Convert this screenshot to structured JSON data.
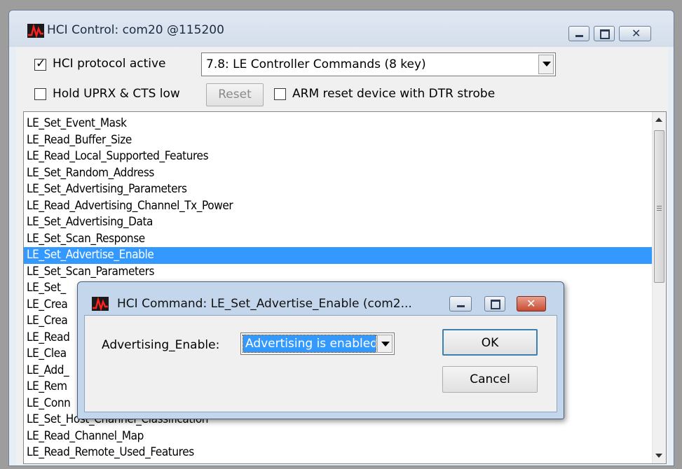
{
  "main_window": {
    "title": "HCI Control: com20  @115200",
    "protocol_active_label": "HCI protocol active",
    "protocol_active_checked": true,
    "command_group_value": "7.8: LE Controller Commands (8 key)",
    "hold_label": "Hold UPRX & CTS low",
    "hold_checked": false,
    "reset_label": "Reset",
    "arm_reset_label": "ARM reset device with DTR strobe",
    "arm_reset_checked": false,
    "commands": [
      "LE_Set_Event_Mask",
      "LE_Read_Buffer_Size",
      "LE_Read_Local_Supported_Features",
      "LE_Set_Random_Address",
      "LE_Set_Advertising_Parameters",
      "LE_Read_Advertising_Channel_Tx_Power",
      "LE_Set_Advertising_Data",
      "LE_Set_Scan_Response",
      "LE_Set_Advertise_Enable",
      "LE_Set_Scan_Parameters",
      "LE_Set_",
      "LE_Crea",
      "LE_Crea",
      "LE_Read",
      "LE_Clea",
      "LE_Add_",
      "LE_Rem",
      "LE_Conn",
      "LE_Set_Host_Channel_Classification",
      "LE_Read_Channel_Map",
      "LE_Read_Remote_Used_Features"
    ],
    "selected_index": 8
  },
  "dialog": {
    "title": "HCI Command: LE_Set_Advertise_Enable (com2...",
    "field_label": "Advertising_Enable:",
    "field_value": "Advertising is enabled",
    "ok_label": "OK",
    "cancel_label": "Cancel"
  },
  "colors": {
    "selection": "#3399ff",
    "close_button": "#c74b32"
  }
}
